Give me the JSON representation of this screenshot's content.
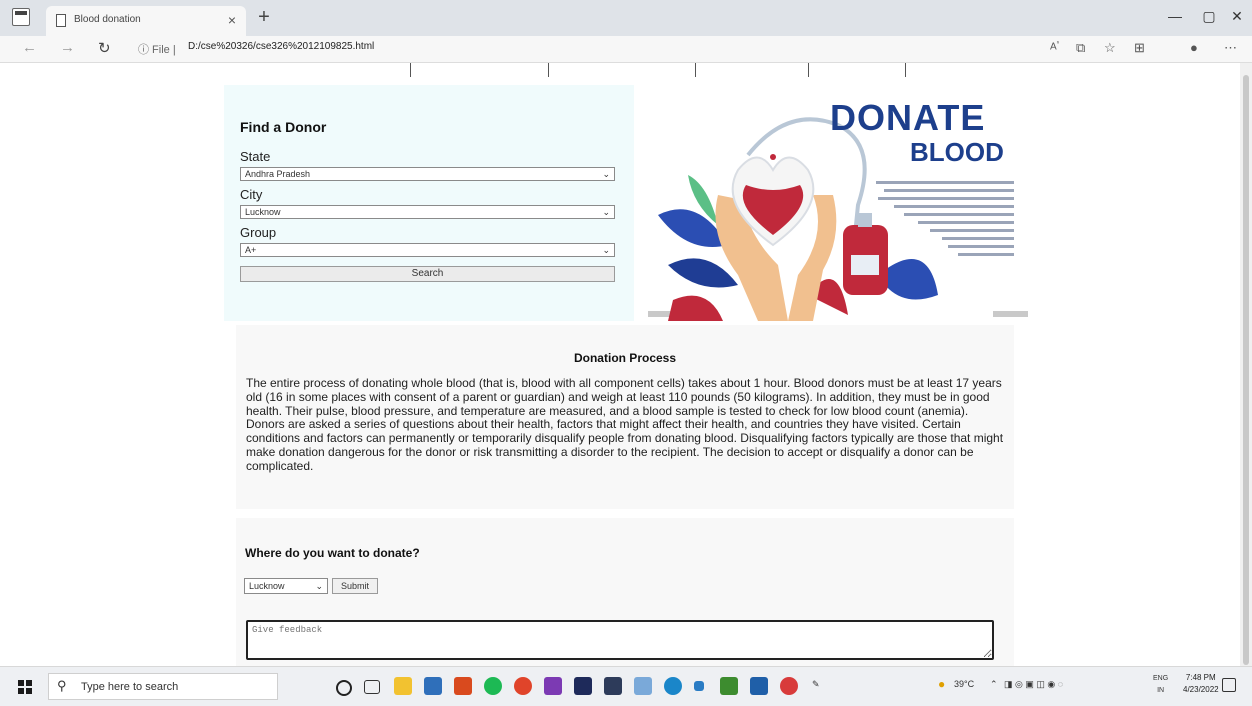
{
  "browser": {
    "tab_title": "Blood donation",
    "tab_close": "×",
    "new_tab": "+",
    "url_info": "ⓘ File |",
    "url": "D:/cse%20326/cse326%2012109825.html",
    "window_controls": [
      "—",
      "▢",
      "✕"
    ]
  },
  "find_donor": {
    "title": "Find a Donor",
    "state_label": "State",
    "state_value": "Andhra Pradesh",
    "city_label": "City",
    "city_value": "Lucknow",
    "group_label": "Group",
    "group_value": "A+",
    "search_label": "Search"
  },
  "banner": {
    "word1": "DONATE",
    "word2": "BLOOD",
    "colors": {
      "heading": "#1d3f8c",
      "blood": "#c0293b",
      "leaf_blue": "#2b4eb3",
      "skin": "#f1c08f"
    }
  },
  "process": {
    "title": "Donation Process",
    "text": "The entire process of donating whole blood (that is, blood with all component cells) takes about 1 hour. Blood donors must be at least 17 years old (16 in some places with consent of a parent or guardian) and weigh at least 110 pounds (50 kilograms). In addition, they must be in good health. Their pulse, blood pressure, and temperature are measured, and a blood sample is tested to check for low blood count (anemia). Donors are asked a series of questions about their health, factors that might affect their health, and countries they have visited. Certain conditions and factors can permanently or temporarily disqualify people from donating blood. Disqualifying factors typically are those that might make donation dangerous for the donor or risk transmitting a disorder to the recipient. The decision to accept or disqualify a donor can be complicated."
  },
  "donate": {
    "title": "Where do you want to donate?",
    "city_value": "Lucknow",
    "submit_label": "Submit",
    "feedback_placeholder": "Give feedback"
  },
  "taskbar": {
    "search_placeholder": "Type here to search",
    "weather": "39°C",
    "lang_top": "ENG",
    "lang_bottom": "IN",
    "time": "7:48 PM",
    "date": "4/23/2022"
  }
}
